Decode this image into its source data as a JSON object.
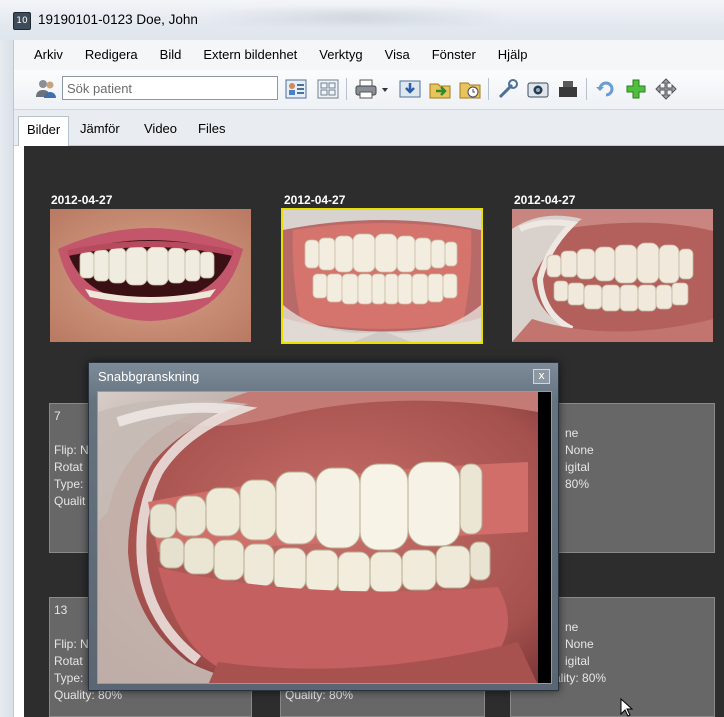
{
  "window": {
    "title": "19190101-0123 Doe, John",
    "icon_label": "10"
  },
  "menu": [
    "Arkiv",
    "Redigera",
    "Bild",
    "Extern bildenhet",
    "Verktyg",
    "Visa",
    "Fönster",
    "Hjälp"
  ],
  "toolbar": {
    "search_placeholder": "Sök patient",
    "icons": [
      "patient-icon",
      "patient-card-icon",
      "grid-view-icon",
      "print-icon",
      "import-icon",
      "export-icon",
      "folder-icon",
      "wrench-icon",
      "camera-icon",
      "scanner-icon",
      "rotate-icon",
      "add-icon",
      "move-icon"
    ]
  },
  "tabs": [
    "Bilder",
    "Jämför",
    "Video",
    "Files"
  ],
  "active_tab": "Bilder",
  "thumbnails": [
    {
      "date": "2012-04-27",
      "view": "frontal-smile"
    },
    {
      "date": "2012-04-27",
      "view": "frontal-retracted",
      "selected": true
    },
    {
      "date": "2012-04-27",
      "view": "lateral-retracted"
    }
  ],
  "info_cards_row1": [
    {
      "number": "7",
      "lines": [
        "Flip: N",
        "Rotat",
        "Type:",
        "Qualit"
      ]
    },
    {
      "number": "",
      "lines": [
        "ne",
        "None",
        "igital",
        "80%"
      ]
    }
  ],
  "info_cards_row2": [
    {
      "number": "13",
      "lines": [
        "Flip: N",
        "Rotat",
        "Type:",
        "Quality: 80%"
      ]
    },
    {
      "number": "",
      "lines": [
        "Quality: 80%"
      ]
    },
    {
      "number": "",
      "lines": [
        "ne",
        "None",
        "igital",
        "Quality: 80%"
      ]
    }
  ],
  "quickview": {
    "title": "Snabbgranskning",
    "close": "x"
  },
  "colors": {
    "selection": "#e8e000",
    "background": "#2d2d2d",
    "card": "#676767"
  }
}
